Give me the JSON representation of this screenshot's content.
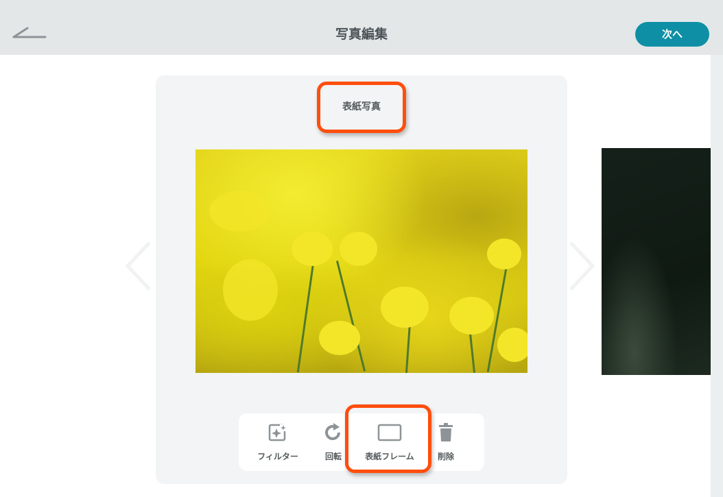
{
  "header": {
    "title": "写真編集",
    "next_label": "次へ"
  },
  "card": {
    "label": "表紙写真"
  },
  "toolbar": {
    "items": [
      {
        "label": "フィルター",
        "icon": "filter-icon"
      },
      {
        "label": "回転",
        "icon": "rotate-icon"
      },
      {
        "label": "表紙フレーム",
        "icon": "frame-icon"
      },
      {
        "label": "削除",
        "icon": "trash-icon"
      }
    ]
  },
  "colors": {
    "accent": "#0f8fa5",
    "highlight": "#ff4e0d",
    "header_bg": "#e3e7e8"
  }
}
